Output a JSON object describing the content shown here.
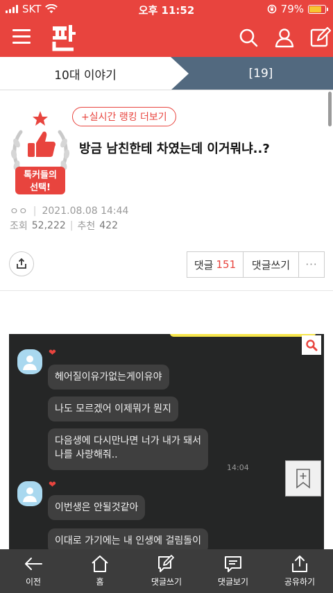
{
  "status": {
    "carrier": "SKT",
    "time": "오후 11:52",
    "battery": "79%",
    "battery_level": 0.79
  },
  "board": {
    "left_label": "10대 이야기",
    "right_label": "[19]"
  },
  "article": {
    "ranking_label": "+실시간 랭킹 더보기",
    "badge_text_1": "톡커들의",
    "badge_text_2": "선택!",
    "title": "방금 남친한테 차였는데 이거뭐냐..?",
    "author": "ㅇㅇ",
    "date": "2021.08.08 14:44",
    "views_label": "조회",
    "views": "52,222",
    "recommend_label": "추천",
    "recommend": "422"
  },
  "actions": {
    "comments_label": "댓글",
    "comments_count": "151",
    "write_label": "댓글쓰기",
    "more_label": "···"
  },
  "chat": {
    "messages": [
      "헤어질이유가없는게이유야",
      "나도 모르겠어 이제뭐가 뭔지",
      "다음생에 다시만나면 너가 내가 돼서",
      "나를 사랑해줘..",
      "이번생은 안될것같아",
      "이대로 가기에는 내 인생에 걸림돌이"
    ],
    "timestamp": "14:04",
    "heart": "❤"
  },
  "nav": [
    {
      "label": "이전",
      "icon": "back-arrow-icon"
    },
    {
      "label": "홈",
      "icon": "home-icon"
    },
    {
      "label": "댓글쓰기",
      "icon": "write-comment-icon"
    },
    {
      "label": "댓글보기",
      "icon": "view-comments-icon"
    },
    {
      "label": "공유하기",
      "icon": "share-icon"
    }
  ],
  "colors": {
    "brand": "#e8443e",
    "board_bar": "#52697f",
    "nav_bg": "#3c3c3c",
    "chat_bg": "#252626"
  }
}
